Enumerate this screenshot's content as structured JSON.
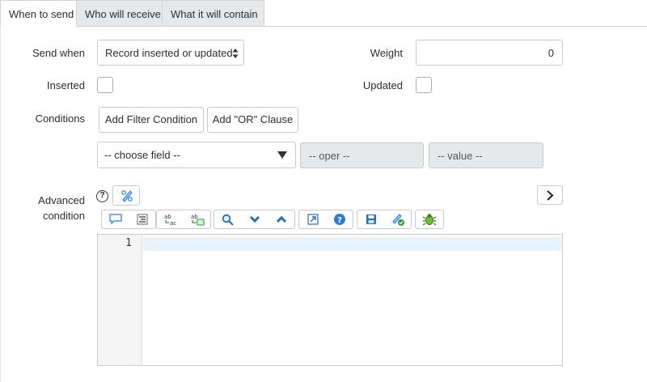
{
  "tabs": [
    {
      "label": "When to send",
      "active": true
    },
    {
      "label": "Who will receive",
      "active": false
    },
    {
      "label": "What it will contain",
      "active": false
    }
  ],
  "form": {
    "send_when": {
      "label": "Send when",
      "value": "Record inserted or updated"
    },
    "weight": {
      "label": "Weight",
      "value": "0"
    },
    "inserted": {
      "label": "Inserted",
      "checked": false
    },
    "updated": {
      "label": "Updated",
      "checked": false
    },
    "conditions": {
      "label": "Conditions",
      "add_filter_label": "Add Filter Condition",
      "add_or_label": "Add \"OR\" Clause",
      "field_placeholder": "-- choose field --",
      "oper_placeholder": "-- oper --",
      "value_placeholder": "-- value --"
    },
    "advanced_condition": {
      "label_line1": "Advanced",
      "label_line2": "condition",
      "help_icon": "?",
      "expand_icon": "chevron-right-icon"
    }
  },
  "editor": {
    "toolbar_icons": [
      [
        "comment-icon",
        "format-icon"
      ],
      [
        "replace-icon",
        "replace-all-icon"
      ],
      [
        "search-icon",
        "next-icon",
        "previous-icon"
      ],
      [
        "fullscreen-icon",
        "help-icon"
      ],
      [
        "save-icon",
        "script-check-icon"
      ],
      [
        "debug-icon"
      ]
    ],
    "line_numbers": [
      "1"
    ],
    "content": ""
  },
  "colors": {
    "accent_blue": "#2a7fd0",
    "disabled_bg": "#e6e8ea",
    "border": "#c7cbd0"
  }
}
